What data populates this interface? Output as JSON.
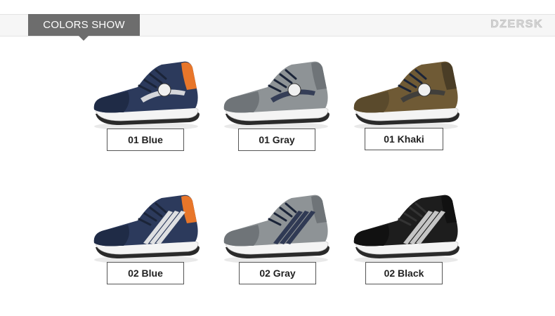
{
  "header": {
    "section_title": "COLORS SHOW",
    "brand": "DZERSK"
  },
  "products": [
    {
      "label": "01 Blue",
      "style": "01",
      "body": "#2c3a5c",
      "panel": "#1f2b46",
      "accent": "#e8e8e8",
      "heel": "#e8762a"
    },
    {
      "label": "01 Gray",
      "style": "01",
      "body": "#8e9396",
      "panel": "#6f7478",
      "accent": "#2b3550",
      "heel": "#6f7478"
    },
    {
      "label": "01 Khaki",
      "style": "01",
      "body": "#6f5a35",
      "panel": "#5a4a2c",
      "accent": "#3c3c3c",
      "heel": "#4a3d26"
    },
    {
      "label": "02 Blue",
      "style": "02",
      "body": "#2c3a5c",
      "panel": "#1f2b46",
      "accent": "#e8e8e8",
      "heel": "#e8762a"
    },
    {
      "label": "02 Gray",
      "style": "02",
      "body": "#8e9396",
      "panel": "#6f7478",
      "accent": "#2b3550",
      "heel": "#6f7478"
    },
    {
      "label": "02 Black",
      "style": "02",
      "body": "#1d1d1d",
      "panel": "#111111",
      "accent": "#cfcfcf",
      "heel": "#111111"
    }
  ]
}
